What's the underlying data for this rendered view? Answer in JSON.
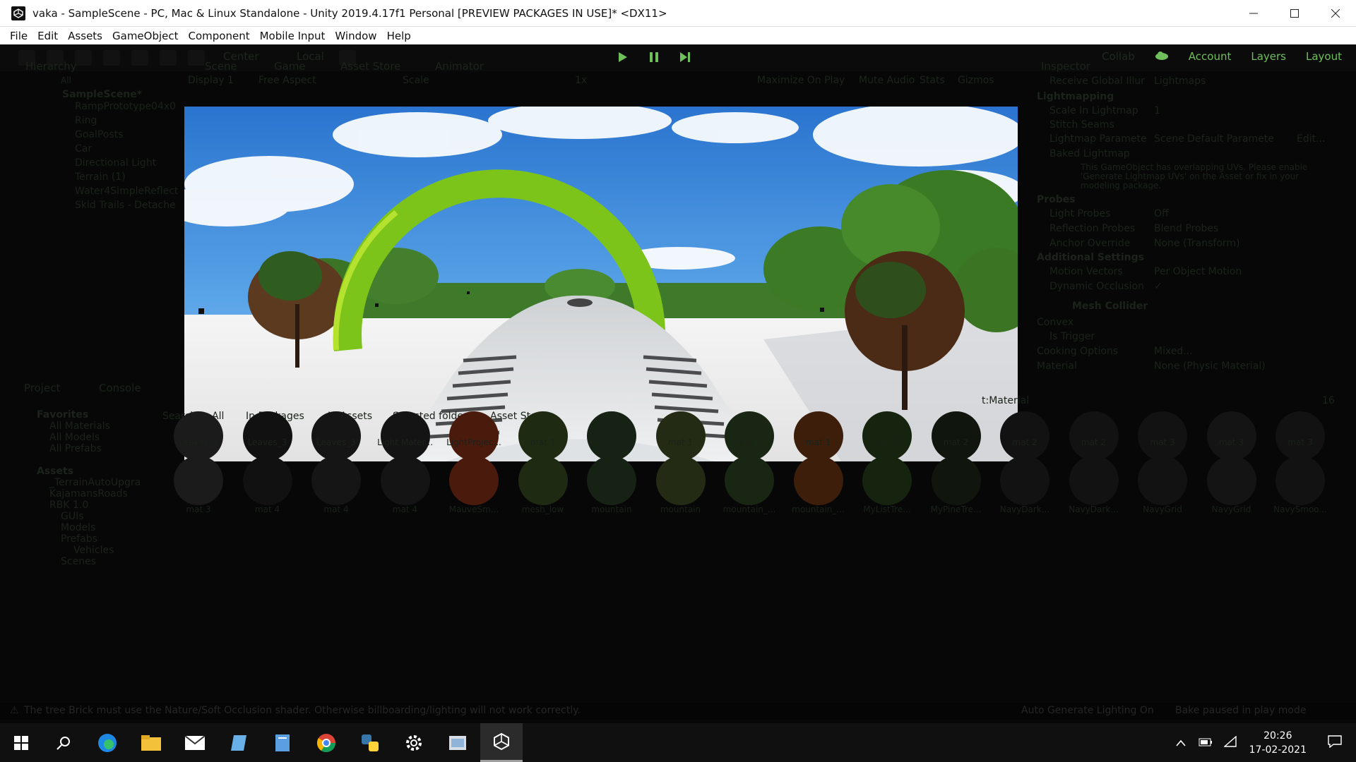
{
  "window": {
    "title": "vaka - SampleScene - PC, Mac & Linux Standalone - Unity 2019.4.17f1 Personal [PREVIEW PACKAGES IN USE]* <DX11>",
    "controls": [
      "minimize-icon",
      "maximize-icon",
      "close-icon"
    ]
  },
  "menu": [
    "File",
    "Edit",
    "Assets",
    "GameObject",
    "Component",
    "Mobile Input",
    "Window",
    "Help"
  ],
  "toolbar": {
    "pivot": "Center",
    "space": "Local",
    "collab": "Collab",
    "account": "Account",
    "layers": "Layers",
    "layout": "Layout"
  },
  "hierarchy": {
    "tab": "Hierarchy",
    "search_placeholder": "All",
    "scene": "SampleScene*",
    "items": [
      "RampPrototype04x0",
      "Ring",
      "GoalPosts",
      "Car",
      "Directional Light",
      "Terrain (1)",
      "Water4SimpleReflect",
      "Skid Trails - Detache"
    ]
  },
  "scene_tabs": [
    "Scene",
    "Game",
    "Asset Store",
    "Animator"
  ],
  "game_bar": {
    "display": "Display 1",
    "aspect": "Free Aspect",
    "scale_label": "Scale",
    "scale_value": "1x",
    "maximize": "Maximize On Play",
    "mute": "Mute Audio",
    "stats": "Stats",
    "gizmos": "Gizmos"
  },
  "inspector": {
    "tab": "Inspector",
    "rows": [
      {
        "label": "Receive Global Illur",
        "value": "Lightmaps"
      },
      {
        "label": "Lightmapping",
        "value": ""
      },
      {
        "label": "Scale In Lightmap",
        "value": "1"
      },
      {
        "label": "Stitch Seams",
        "value": ""
      },
      {
        "label": "Lightmap Paramete",
        "value": "Scene Default Paramete"
      },
      {
        "label": "Baked Lightmap",
        "value": ""
      }
    ],
    "edit_label": "Edit...",
    "warning": "This GameObject has overlapping UVs. Please enable 'Generate Lightmap UVs' on the Asset or fix in your modeling package.",
    "probes_header": "Probes",
    "probe_rows": [
      {
        "label": "Light Probes",
        "value": "Off"
      },
      {
        "label": "Reflection Probes",
        "value": "Blend Probes"
      },
      {
        "label": "Anchor Override",
        "value": "None (Transform)"
      }
    ],
    "additional_header": "Additional Settings",
    "additional_rows": [
      {
        "label": "Motion Vectors",
        "value": "Per Object Motion"
      },
      {
        "label": "Dynamic Occlusion",
        "value": "✓"
      }
    ],
    "component": "Mesh Collider",
    "collider_rows": [
      {
        "label": "Convex",
        "value": ""
      },
      {
        "label": "Is Trigger",
        "value": ""
      },
      {
        "label": "Cooking Options",
        "value": "Mixed..."
      },
      {
        "label": "Material",
        "value": "None (Physic Material)"
      }
    ]
  },
  "project": {
    "tabs": [
      "Project",
      "Console"
    ],
    "search_value": "t:Material",
    "count": "16",
    "search_label": "Search:",
    "filters": [
      "All",
      "In Packages",
      "In Assets",
      "Selected folder",
      "Asset Store"
    ],
    "favorites_header": "Favorites",
    "favorites": [
      "All Materials",
      "All Models",
      "All Prefabs"
    ],
    "assets_header": "Assets",
    "folders": [
      "_TerrainAutoUpgra",
      "KajamansRoads",
      "RBK 1.0",
      "GUIs",
      "Models",
      "Prefabs",
      "Vehicles",
      "Scenes"
    ],
    "row1": [
      "Leaves_3",
      "Leaves_3",
      "Leaves_3",
      "Light Mater...",
      "LightProjec...",
      "mat 1",
      "mat 1",
      "mat 1",
      "mat 1",
      "mat 1",
      "mat 2",
      "mat 2",
      "mat 2",
      "mat 2",
      "mat 3",
      "mat 3",
      "mat 3"
    ],
    "row2": [
      "mat 3",
      "mat 4",
      "mat 4",
      "mat 4",
      "MauveSm...",
      "mesh_low",
      "mountain",
      "mountain",
      "mountain_...",
      "mountain_...",
      "MyListTre...",
      "MyPineTre...",
      "NavyDark...",
      "NavyDark...",
      "NavyGrid",
      "NavyGrid",
      "NavySmoo..."
    ]
  },
  "status": {
    "warning": "The tree Brick must use the Nature/Soft Occlusion shader. Otherwise billboarding/lighting will not work correctly.",
    "auto_generate": "Auto Generate Lighting On",
    "bake": "Bake paused in play mode"
  },
  "taskbar": {
    "apps": [
      "windows-start-icon",
      "search-icon",
      "edge-icon",
      "file-explorer-icon",
      "mail-icon",
      "app-icon",
      "notes-icon",
      "chrome-icon",
      "python-icon",
      "settings-icon",
      "app2-icon",
      "unity-icon"
    ],
    "time": "20:26",
    "date": "17-02-2021"
  },
  "colors": {
    "play_accent": "#6fbf5a",
    "ring": "#7dc41a",
    "sky": "#2e7fd6"
  }
}
